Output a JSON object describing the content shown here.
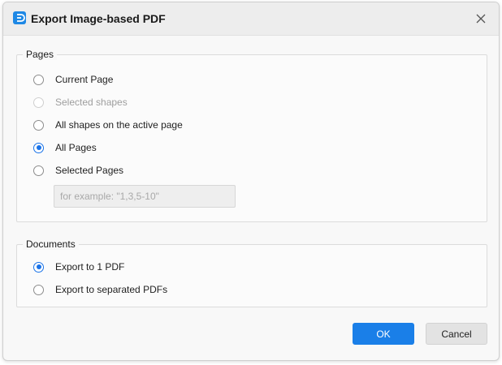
{
  "window": {
    "title": "Export Image-based PDF",
    "app_icon": "edraw-logo-icon",
    "close_icon": "close-icon",
    "accent_color": "#1a7fe8"
  },
  "pages_group": {
    "legend": "Pages",
    "options": [
      {
        "label": "Current Page",
        "checked": false,
        "disabled": false
      },
      {
        "label": "Selected shapes",
        "checked": false,
        "disabled": true
      },
      {
        "label": "All shapes on the active page",
        "checked": false,
        "disabled": false
      },
      {
        "label": "All Pages",
        "checked": true,
        "disabled": false
      },
      {
        "label": "Selected Pages",
        "checked": false,
        "disabled": false
      }
    ],
    "range_input": {
      "value": "",
      "placeholder": "for example: \"1,3,5-10\""
    }
  },
  "documents_group": {
    "legend": "Documents",
    "options": [
      {
        "label": "Export to 1 PDF",
        "checked": true,
        "disabled": false
      },
      {
        "label": "Export to separated PDFs",
        "checked": false,
        "disabled": false
      }
    ]
  },
  "buttons": {
    "ok_label": "OK",
    "cancel_label": "Cancel"
  }
}
